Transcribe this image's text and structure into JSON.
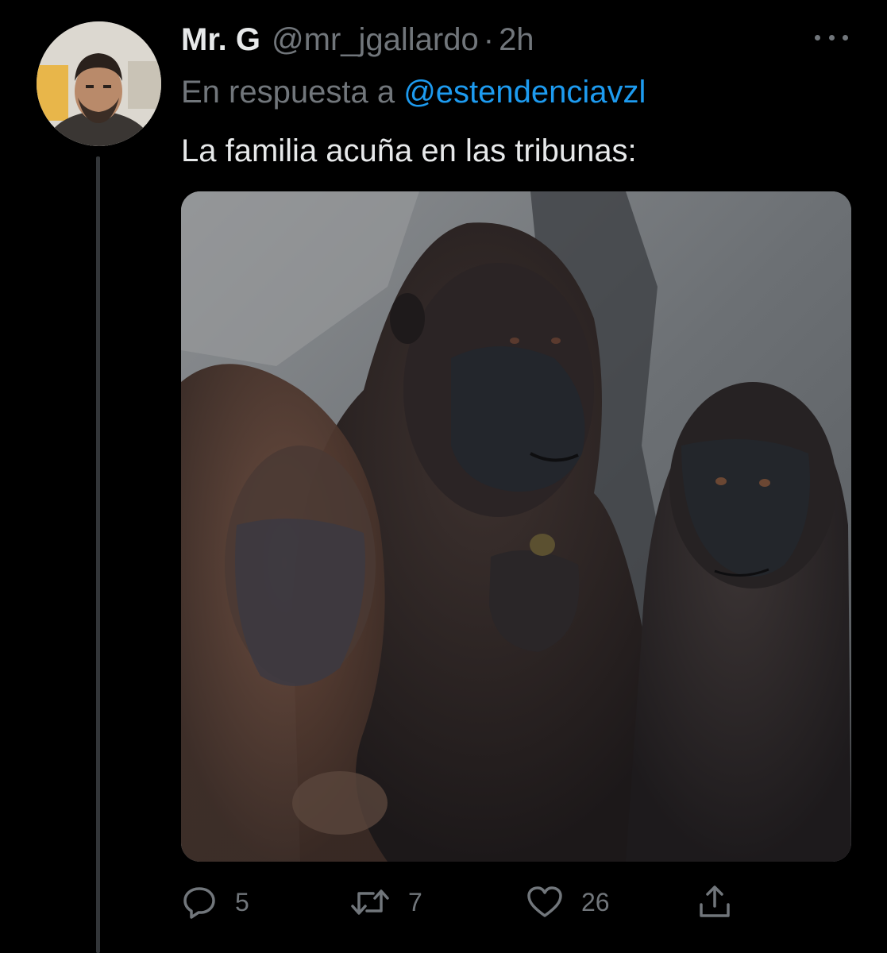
{
  "author": {
    "display_name": "Mr. G",
    "handle": "@mr_jgallardo",
    "separator": "·",
    "time": "2h"
  },
  "reply": {
    "prefix": "En respuesta a",
    "mention": "@estendenciavzl"
  },
  "tweet": {
    "text": "La familia acuña en las tribunas:"
  },
  "media": {
    "description_icon": "gorillas-photo"
  },
  "actions": {
    "reply_count": "5",
    "retweet_count": "7",
    "like_count": "26"
  },
  "colors": {
    "background": "#000000",
    "primary_text": "#e7e9ea",
    "secondary_text": "#71767b",
    "accent": "#1d9bf0",
    "thread_line": "#333639"
  },
  "icons": {
    "more": "more-horizontal-icon",
    "reply": "reply-bubble-icon",
    "retweet": "retweet-icon",
    "like": "heart-icon",
    "share": "share-upload-icon"
  }
}
